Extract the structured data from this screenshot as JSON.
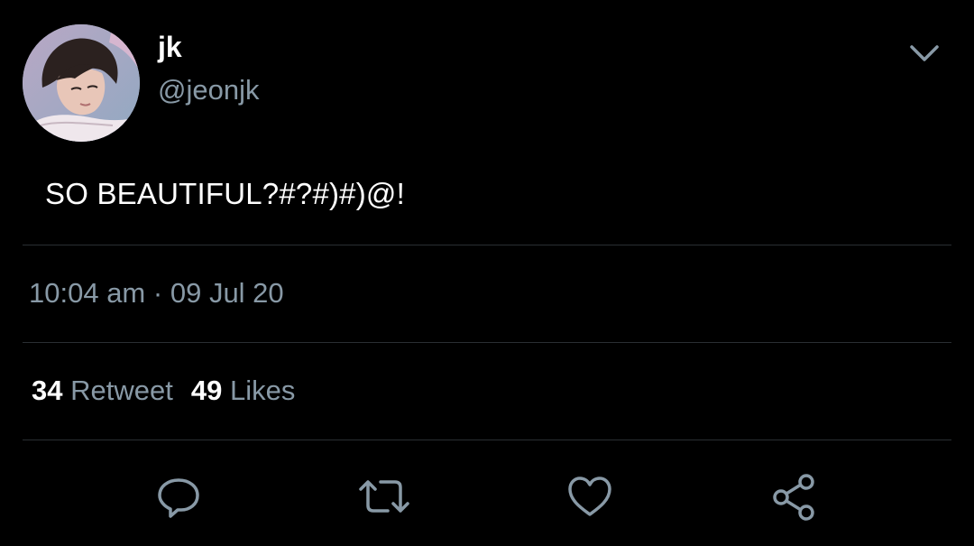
{
  "user": {
    "display_name": "jk",
    "handle": "@jeonjk",
    "avatar_icon": "profile-photo"
  },
  "tweet": {
    "text": "SO BEAUTIFUL?#?#)#)@!"
  },
  "meta": {
    "time": "10:04 am",
    "separator": "·",
    "date": "09 Jul 20"
  },
  "stats": {
    "retweet_count": "34",
    "retweet_label": "Retweet",
    "like_count": "49",
    "like_label": "Likes"
  },
  "actions": {
    "reply_icon": "reply-icon",
    "retweet_icon": "retweet-icon",
    "like_icon": "heart-icon",
    "share_icon": "share-icon"
  },
  "colors": {
    "background": "#000000",
    "primary_text": "#ffffff",
    "secondary_text": "#8899a6",
    "divider": "#2a2e33"
  }
}
